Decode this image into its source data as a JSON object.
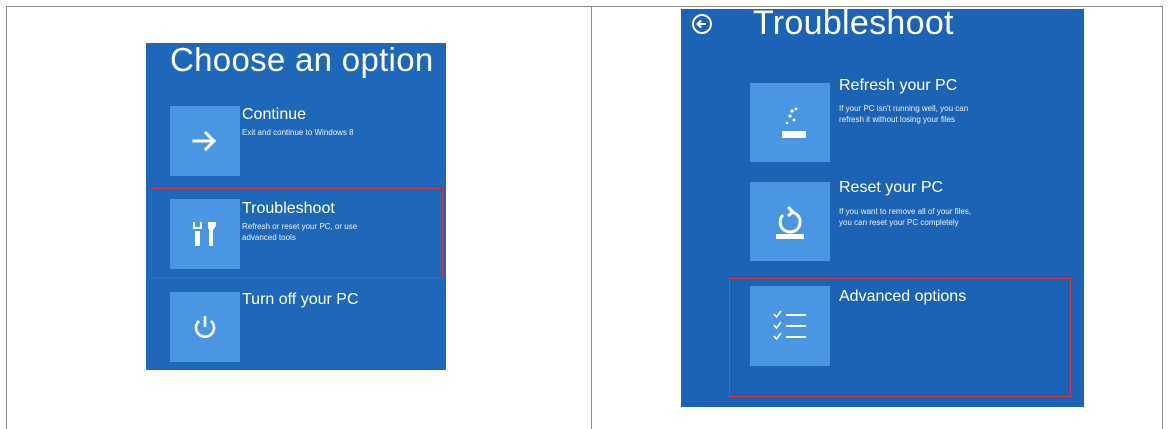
{
  "left": {
    "title": "Choose an option",
    "options": [
      {
        "label": "Continue",
        "desc": "Exit and continue to Windows 8",
        "icon": "arrow-right-icon"
      },
      {
        "label": "Troubleshoot",
        "desc": "Refresh or reset your PC, or use\nadvanced tools",
        "icon": "tools-icon"
      },
      {
        "label": "Turn off your PC",
        "desc": "",
        "icon": "power-icon"
      }
    ]
  },
  "right": {
    "title": "Troubleshoot",
    "options": [
      {
        "label": "Refresh your PC",
        "desc": "If your PC isn't running well, you can\nrefresh it without losing your files",
        "icon": "refresh-pc-icon"
      },
      {
        "label": "Reset your PC",
        "desc": "If you want to remove all of your files,\nyou can reset your PC completely",
        "icon": "reset-pc-icon"
      },
      {
        "label": "Advanced options",
        "desc": "",
        "icon": "checklist-icon"
      }
    ]
  },
  "colors": {
    "background": "#1f67b8",
    "tile": "#4a96e3",
    "highlight": "#d6333f"
  }
}
